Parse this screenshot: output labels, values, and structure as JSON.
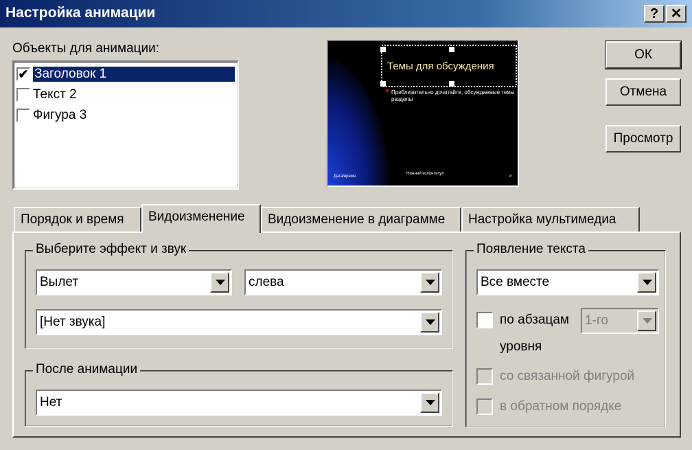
{
  "window": {
    "title": "Настройка анимации",
    "help_label": "?",
    "close_label": "✕"
  },
  "objects": {
    "label": "Объекты для анимации:",
    "items": [
      {
        "label": "Заголовок 1",
        "checked": true,
        "selected": true
      },
      {
        "label": "Текст 2",
        "checked": false,
        "selected": false
      },
      {
        "label": "Фигура 3",
        "checked": false,
        "selected": false
      }
    ]
  },
  "preview": {
    "title_text": "Темы для обсуждения",
    "body_text": "Приблизительно дочитайте, обсуждаемые темы",
    "body_text2": "разделы",
    "footer_left": "Дата/время",
    "footer_center": "Нижний колонтитул",
    "footer_right": "#"
  },
  "buttons": {
    "ok": "ОК",
    "cancel": "Отмена",
    "preview": "Просмотр"
  },
  "tabs": [
    {
      "label": "Порядок и время",
      "active": false
    },
    {
      "label": "Видоизменение",
      "active": true
    },
    {
      "label": "Видоизменение в диаграмме",
      "active": false
    },
    {
      "label": "Настройка мультимедиа",
      "active": false
    }
  ],
  "effect_group": {
    "label": "Выберите эффект и звук",
    "effect_value": "Вылет",
    "direction_value": "слева",
    "sound_value": "[Нет звука]"
  },
  "after_group": {
    "label": "После анимации",
    "value": "Нет"
  },
  "text_group": {
    "label": "Появление текста",
    "mode_value": "Все вместе",
    "by_paragraph_label": "по абзацам",
    "level_value": "1-го",
    "level_suffix": "уровня",
    "linked_shape_label": "со связанной фигурой",
    "reverse_order_label": "в обратном порядке"
  },
  "colors": {
    "title_bar": "#0a246a",
    "face": "#d4d0c8",
    "selection": "#0a246a"
  }
}
